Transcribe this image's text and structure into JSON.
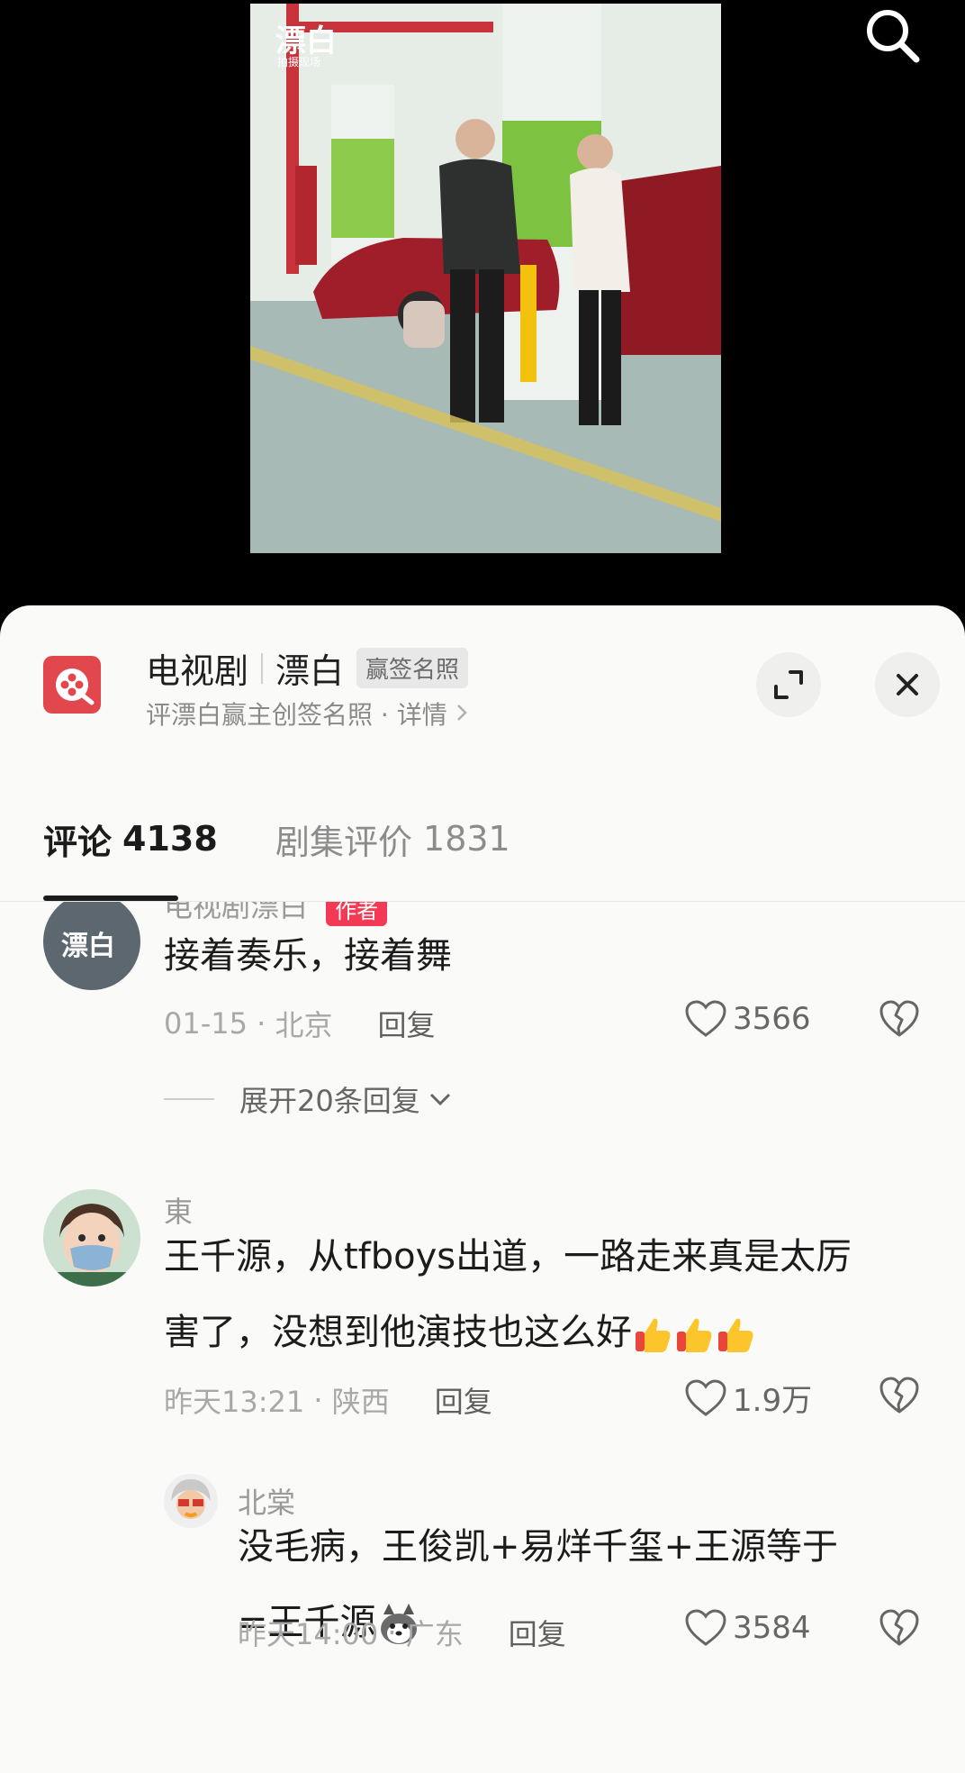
{
  "video": {
    "watermark_title": "漂白",
    "watermark_sub": "拍摄现场"
  },
  "show": {
    "category": "电视剧",
    "name": "漂白",
    "badge": "赢签名照",
    "subtitle": "评漂白赢主创签名照 · 详情"
  },
  "tabs": [
    {
      "label": "评论",
      "count": "4138"
    },
    {
      "label": "剧集评价",
      "count": "1831"
    }
  ],
  "comments": [
    {
      "username": "电视剧漂白",
      "tag": "作者",
      "avatar_text": "漂白",
      "text": "接着奏乐，接着舞",
      "date": "01-15",
      "location": "北京",
      "reply_label": "回复",
      "likes": "3566",
      "expand_label": "展开20条回复"
    },
    {
      "username": "東",
      "text_line1": "王千源，从tfboys出道，一路走来真是太厉",
      "text_line2": "害了，没想到他演技也这么好",
      "date": "昨天13:21",
      "location": "陕西",
      "reply_label": "回复",
      "likes": "1.9万"
    },
    {
      "username": "北棠",
      "text_line1": "没毛病，王俊凯+易烊千玺+王源等于",
      "text_line2": "=王千源",
      "date": "昨天14:00",
      "location": "广东",
      "reply_label": "回复",
      "likes": "3584"
    }
  ],
  "colors": {
    "accent_red": "#e2474d",
    "author_tag": "#f33a55",
    "sheet_bg": "#fafaf8"
  }
}
